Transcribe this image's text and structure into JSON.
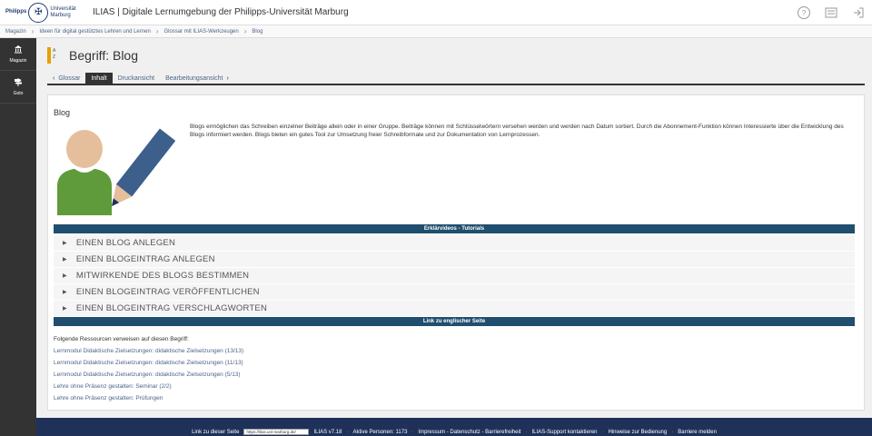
{
  "header": {
    "logo_line1": "Philipps",
    "logo_line2": "Universität",
    "logo_line3": "Marburg",
    "title": "ILIAS | Digitale Lernumgebung der Philipps-Universität Marburg",
    "icons": [
      "help-icon",
      "notification-icon",
      "logout-icon"
    ]
  },
  "breadcrumb": [
    "Magazin",
    "Ideen für digital gestütztes Lehren und Lernen",
    "Glossar mit ILIAS-Werkzeugen",
    "Blog"
  ],
  "sidebar": {
    "items": [
      {
        "label": "Magazin",
        "icon": "repository-icon"
      },
      {
        "label": "Goto",
        "icon": "signpost-icon"
      }
    ]
  },
  "page": {
    "title": "Begriff: Blog",
    "az_label_top": "A",
    "az_label_bottom": "Z"
  },
  "tabs": {
    "back": "Glossar",
    "items": [
      "Inhalt",
      "Druckansicht",
      "Bearbeitungsansicht"
    ],
    "active": "Inhalt"
  },
  "content": {
    "title": "Blog",
    "description": "Blogs ermöglichen das Schreiben einzelner Beiträge allein oder in einer Gruppe. Beiträge können mit Schlüsselwörtern versehen werden und werden nach Datum sortiert. Durch die Abonnement-Funktion können Interessierte über die Entwicklung des Blogs informiert werden. Blogs bieten ein gutes Tool zur Umsetzung freier Schreibformate und zur Dokumentation von Lernprozessen.",
    "tutorial_header": "Erklärvideos - Tutorials",
    "accordion": [
      "EINEN BLOG ANLEGEN",
      "EINEN BLOGEINTRAG ANLEGEN",
      "MITWIRKENDE DES BLOGS BESTIMMEN",
      "EINEN BLOGEINTRAG VERÖFFENTLICHEN",
      "EINEN BLOGEINTRAG VERSCHLAGWORTEN"
    ],
    "english_link": "Link zu englischer Seite",
    "refs_intro": "Folgende Ressourcen verweisen auf diesen Begriff:",
    "refs": [
      "Lernmodul Didaktische Zielsetzungen: didaktische Zielsetzungen (13/13)",
      "Lernmodul Didaktische Zielsetzungen: didaktische Zielsetzungen (11/13)",
      "Lernmodul Didaktische Zielsetzungen: didaktische Zielsetzungen (5/13)",
      "Lehre ohne Präsenz gestalten: Seminar (2/2)",
      "Lehre ohne Präsenz gestalten: Prüfungen"
    ]
  },
  "footer": {
    "link_label": "Link zu dieser Seite",
    "link_value": "https://ilias.uni-marburg.de/",
    "version": "ILIAS v7.18",
    "active_persons": "Aktive Personen: 1173",
    "legal": "Impressum - Datenschutz - Barrierefreiheit",
    "support": "ILIAS-Support kontaktieren",
    "usage": "Hinweise zur Bedienung",
    "report": "Barriere melden"
  },
  "colors": {
    "sidebar": "#333333",
    "accent_bar": "#1f4e6f",
    "footer": "#1f3059",
    "link": "#4c6586",
    "glossary_icon": "#e6a000"
  }
}
